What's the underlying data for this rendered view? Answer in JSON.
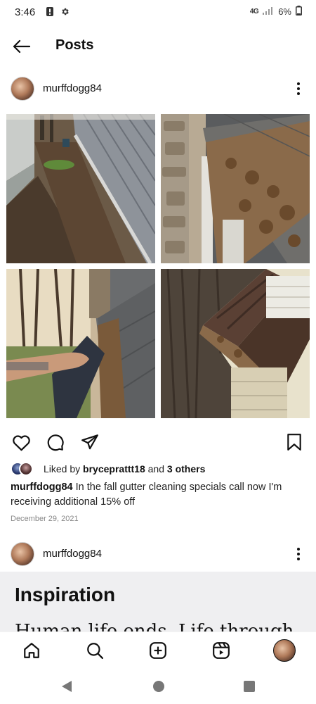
{
  "status_bar": {
    "time": "3:46",
    "network": "4G",
    "battery": "6%",
    "icons": [
      "alert-icon",
      "settings-icon",
      "signal-icon",
      "battery-icon"
    ]
  },
  "header": {
    "title": "Posts",
    "back_icon": "back-arrow-icon"
  },
  "post": {
    "username": "murffdogg84",
    "images": [
      {
        "name": "gutter-side-yard"
      },
      {
        "name": "gutter-leaves-roof"
      },
      {
        "name": "gutter-cleaning-hand"
      },
      {
        "name": "gutter-roof-corner"
      }
    ],
    "actions": [
      "heart-icon",
      "comment-icon",
      "share-icon",
      "bookmark-icon"
    ],
    "likes": {
      "prefix": "Liked by",
      "user": "bryceprattt18",
      "conjunction": "and",
      "others": "3 others"
    },
    "caption": {
      "user": "murffdogg84",
      "text": "In the fall gutter cleaning specials call now I'm receiving additional 15% off"
    },
    "date": "December 29, 2021"
  },
  "next_post": {
    "username": "murffdogg84",
    "title": "Inspiration",
    "body_preview": "Human life ends. Life through"
  },
  "bottom_nav": {
    "items": [
      "home-icon",
      "search-icon",
      "create-icon",
      "reels-icon",
      "profile-avatar"
    ]
  },
  "system_nav": {
    "items": [
      "back-triangle-icon",
      "home-circle-icon",
      "recents-square-icon"
    ]
  },
  "colors": {
    "text": "#111111",
    "muted": "#888888",
    "text_post_bg": "#efeff1"
  }
}
